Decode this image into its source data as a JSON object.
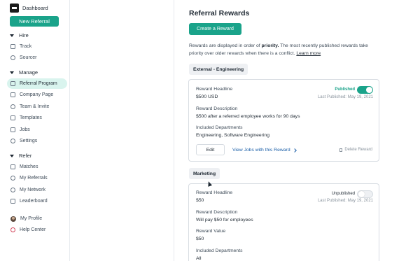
{
  "sidebar": {
    "brand_label": "Dashboard",
    "new_referral": "New Referral",
    "sections": {
      "hire": "Hire",
      "manage": "Manage",
      "refer": "Refer"
    },
    "items": {
      "track": "Track",
      "sourcer": "Sourcer",
      "referral_program": "Referral Program",
      "company_page": "Company Page",
      "team_invite": "Team & Invite",
      "templates": "Templates",
      "jobs": "Jobs",
      "settings": "Settings",
      "matches": "Matches",
      "my_referrals": "My Referrals",
      "my_network": "My Network",
      "leaderboard": "Leaderboard",
      "my_profile": "My Profile",
      "help_center": "Help Center"
    }
  },
  "main": {
    "title": "Referral Rewards",
    "create_button": "Create a Reward",
    "intro_prefix": "Rewards are displayed in order of ",
    "intro_bold": "priority.",
    "intro_suffix": " The most recently published rewards take priority over older rewards when there is a conflict. ",
    "intro_link": "Learn more",
    "groups": [
      {
        "tag": "External - Engineering",
        "card": {
          "headline_label": "Reward Headline",
          "headline_value": "$500 USD",
          "status": "Published",
          "published": true,
          "last_published": "Last Published: May 19, 2021",
          "description_label": "Reward Description",
          "description_value": "$500 after a referred employee works for 90 days",
          "departments_label": "Included Departments",
          "departments_value": "Engineering, Software Engineering",
          "edit_label": "Edit",
          "view_jobs_label": "View Jobs with this Reward",
          "delete_label": "Delete Reward"
        }
      },
      {
        "tag": "Marketing",
        "card": {
          "headline_label": "Reward Headline",
          "headline_value": "$50",
          "status": "Unpublished",
          "published": false,
          "last_published": "Last Published: May 19, 2021",
          "description_label": "Reward Description",
          "description_value": "Will pay $50 for employees",
          "value_label": "Reward Value",
          "value_value": "$50",
          "departments_label": "Included Departments",
          "departments_value": "All"
        }
      }
    ]
  },
  "colors": {
    "accent": "#1aa38a",
    "active_nav_bg": "#d9f4ee",
    "link": "#1b5fa8"
  }
}
